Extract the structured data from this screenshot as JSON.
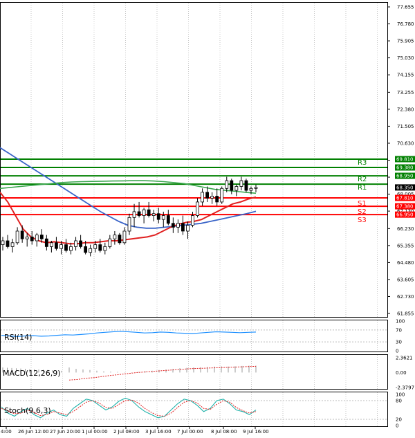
{
  "chart_data": {
    "type": "candlestick",
    "main_panel": {
      "y_ticks": [
        "77.655",
        "76.780",
        "75.905",
        "75.030",
        "74.155",
        "73.255",
        "72.380",
        "71.505",
        "70.630",
        "69.755",
        "68.880",
        "68.005",
        "67.130",
        "66.230",
        "65.355",
        "64.480",
        "63.605",
        "62.730",
        "61.855"
      ],
      "y_range": [
        61.855,
        77.655
      ],
      "levels": [
        {
          "name": "R3",
          "value": 69.81,
          "price_label": "69.810",
          "color": "#008000"
        },
        {
          "name": "",
          "value": 69.38,
          "price_label": "69.380",
          "color": "#008000"
        },
        {
          "name": "R2",
          "value": 68.95,
          "price_label": "68.950",
          "color": "#008000"
        },
        {
          "name": "R1",
          "value": 68.52,
          "price_label": "",
          "color": "#008000"
        },
        {
          "name": "S1",
          "value": 67.81,
          "price_label": "67.810",
          "color": "#ff0000"
        },
        {
          "name": "S2",
          "value": 67.38,
          "price_label": "67.380",
          "color": "#ff0000"
        },
        {
          "name": "S3",
          "value": 66.95,
          "price_label": "66.950",
          "color": "#ff0000"
        }
      ],
      "current_price": 68.35,
      "current_price_label": "68.350",
      "candles": [
        {
          "o": 65.4,
          "h": 65.8,
          "l": 65.1,
          "c": 65.6
        },
        {
          "o": 65.6,
          "h": 65.9,
          "l": 65.2,
          "c": 65.3
        },
        {
          "o": 65.3,
          "h": 65.7,
          "l": 65.0,
          "c": 65.5
        },
        {
          "o": 65.5,
          "h": 66.3,
          "l": 65.4,
          "c": 66.1
        },
        {
          "o": 66.1,
          "h": 66.4,
          "l": 65.5,
          "c": 65.7
        },
        {
          "o": 65.7,
          "h": 66.0,
          "l": 65.3,
          "c": 65.8
        },
        {
          "o": 65.8,
          "h": 66.1,
          "l": 65.4,
          "c": 65.6
        },
        {
          "o": 65.6,
          "h": 66.0,
          "l": 65.3,
          "c": 65.9
        },
        {
          "o": 65.9,
          "h": 66.2,
          "l": 65.5,
          "c": 65.7
        },
        {
          "o": 65.7,
          "h": 65.9,
          "l": 65.1,
          "c": 65.3
        },
        {
          "o": 65.3,
          "h": 65.6,
          "l": 65.0,
          "c": 65.5
        },
        {
          "o": 65.5,
          "h": 65.8,
          "l": 65.1,
          "c": 65.2
        },
        {
          "o": 65.2,
          "h": 65.6,
          "l": 64.9,
          "c": 65.4
        },
        {
          "o": 65.4,
          "h": 65.7,
          "l": 65.0,
          "c": 65.1
        },
        {
          "o": 65.1,
          "h": 65.5,
          "l": 64.9,
          "c": 65.3
        },
        {
          "o": 65.3,
          "h": 65.8,
          "l": 65.1,
          "c": 65.6
        },
        {
          "o": 65.6,
          "h": 65.9,
          "l": 65.2,
          "c": 65.3
        },
        {
          "o": 65.3,
          "h": 65.6,
          "l": 64.9,
          "c": 65.0
        },
        {
          "o": 65.0,
          "h": 65.4,
          "l": 64.8,
          "c": 65.2
        },
        {
          "o": 65.2,
          "h": 65.6,
          "l": 65.0,
          "c": 65.4
        },
        {
          "o": 65.4,
          "h": 65.7,
          "l": 65.0,
          "c": 65.1
        },
        {
          "o": 65.1,
          "h": 65.5,
          "l": 64.9,
          "c": 65.3
        },
        {
          "o": 65.3,
          "h": 65.9,
          "l": 65.2,
          "c": 65.7
        },
        {
          "o": 65.7,
          "h": 66.1,
          "l": 65.4,
          "c": 65.9
        },
        {
          "o": 65.9,
          "h": 66.0,
          "l": 65.4,
          "c": 65.5
        },
        {
          "o": 65.5,
          "h": 66.3,
          "l": 65.4,
          "c": 66.1
        },
        {
          "o": 66.1,
          "h": 67.0,
          "l": 65.9,
          "c": 66.8
        },
        {
          "o": 66.8,
          "h": 67.5,
          "l": 66.3,
          "c": 67.1
        },
        {
          "o": 67.1,
          "h": 67.6,
          "l": 66.8,
          "c": 66.9
        },
        {
          "o": 66.9,
          "h": 67.3,
          "l": 66.5,
          "c": 67.2
        },
        {
          "o": 67.2,
          "h": 67.6,
          "l": 66.8,
          "c": 66.9
        },
        {
          "o": 66.9,
          "h": 67.2,
          "l": 66.6,
          "c": 67.0
        },
        {
          "o": 67.0,
          "h": 67.3,
          "l": 66.5,
          "c": 66.7
        },
        {
          "o": 66.7,
          "h": 67.1,
          "l": 66.3,
          "c": 66.9
        },
        {
          "o": 66.9,
          "h": 67.2,
          "l": 66.4,
          "c": 66.5
        },
        {
          "o": 66.5,
          "h": 66.8,
          "l": 66.0,
          "c": 66.3
        },
        {
          "o": 66.3,
          "h": 66.7,
          "l": 66.0,
          "c": 66.5
        },
        {
          "o": 66.5,
          "h": 66.9,
          "l": 65.9,
          "c": 66.1
        },
        {
          "o": 66.1,
          "h": 66.6,
          "l": 65.7,
          "c": 66.4
        },
        {
          "o": 66.4,
          "h": 67.1,
          "l": 66.3,
          "c": 66.9
        },
        {
          "o": 66.9,
          "h": 67.8,
          "l": 66.8,
          "c": 67.6
        },
        {
          "o": 67.6,
          "h": 68.3,
          "l": 67.4,
          "c": 68.1
        },
        {
          "o": 68.1,
          "h": 68.4,
          "l": 67.6,
          "c": 67.8
        },
        {
          "o": 67.8,
          "h": 68.1,
          "l": 67.5,
          "c": 67.9
        },
        {
          "o": 67.9,
          "h": 68.3,
          "l": 67.4,
          "c": 67.6
        },
        {
          "o": 67.6,
          "h": 68.4,
          "l": 67.5,
          "c": 68.3
        },
        {
          "o": 68.3,
          "h": 68.9,
          "l": 68.1,
          "c": 68.7
        },
        {
          "o": 68.7,
          "h": 68.8,
          "l": 68.0,
          "c": 68.2
        },
        {
          "o": 68.2,
          "h": 68.5,
          "l": 67.9,
          "c": 68.4
        },
        {
          "o": 68.4,
          "h": 68.9,
          "l": 68.2,
          "c": 68.7
        },
        {
          "o": 68.7,
          "h": 68.8,
          "l": 68.1,
          "c": 68.2
        },
        {
          "o": 68.2,
          "h": 68.4,
          "l": 68.0,
          "c": 68.3
        },
        {
          "o": 68.3,
          "h": 68.5,
          "l": 68.1,
          "c": 68.35
        }
      ],
      "ma_slow_blue": [
        70.4,
        70.1,
        69.8,
        69.5,
        69.2,
        68.9,
        68.6,
        68.3,
        68.0,
        67.7,
        67.4,
        67.1,
        66.85,
        66.6,
        66.4,
        66.3,
        66.25,
        66.25,
        66.3,
        66.35,
        66.4,
        66.45,
        66.5,
        66.6,
        66.7,
        66.8,
        66.9,
        67.0,
        67.12
      ],
      "ma_mid_green": [
        68.3,
        68.35,
        68.4,
        68.45,
        68.5,
        68.55,
        68.6,
        68.63,
        68.65,
        68.66,
        68.67,
        68.68,
        68.69,
        68.7,
        68.7,
        68.68,
        68.65,
        68.6,
        68.55,
        68.45,
        68.35,
        68.25,
        68.2,
        68.15,
        68.1,
        68.05
      ],
      "ma_fast_red": [
        68.1,
        67.6,
        66.9,
        66.2,
        65.8,
        65.6,
        65.5,
        65.55,
        65.5,
        65.45,
        65.45,
        65.5,
        65.5,
        65.55,
        65.6,
        65.6,
        65.65,
        65.7,
        65.75,
        65.8,
        65.9,
        66.1,
        66.3,
        66.45,
        66.55,
        66.6,
        66.7,
        66.9,
        67.1,
        67.3,
        67.5,
        67.6,
        67.75,
        67.85
      ]
    },
    "x_labels": [
      "4:00",
      "26 Jun 12:00",
      "27 Jun 20:00",
      "1 Jul 00:00",
      "2 Jul 08:00",
      "3 Jul 16:00",
      "7 Jul 00:00",
      "8 Jul 08:00",
      "9 Jul 16:00"
    ],
    "rsi_panel": {
      "label": "RSI(14)",
      "y_ticks": [
        "100",
        "70",
        "30",
        "0"
      ],
      "values": [
        52,
        50,
        48,
        50,
        51,
        49,
        50,
        52,
        54,
        53,
        55,
        57,
        60,
        62,
        64,
        66,
        64,
        62,
        60,
        61,
        63,
        62,
        60,
        59,
        58,
        60,
        62,
        64,
        63,
        62,
        61,
        62,
        63
      ]
    },
    "macd_panel": {
      "label": "MACD(12,26,9)",
      "y_ticks": [
        "2.3621",
        "0.00",
        "-2.3797"
      ],
      "histogram": [
        0.8,
        0.6,
        0.5,
        0.4,
        0.3,
        0.2,
        0.15,
        0.1,
        0.05,
        0.05,
        0.1,
        0.2,
        0.3,
        0.4,
        0.5,
        0.6,
        0.7,
        0.75,
        0.8,
        0.85,
        0.9,
        0.95,
        1.0,
        0.95,
        1.0,
        1.05,
        1.1,
        1.1
      ],
      "signal": [
        -1.2,
        -1.1,
        -0.9,
        -0.8,
        -0.6,
        -0.45,
        -0.3,
        -0.15,
        0.0,
        0.1,
        0.2,
        0.3,
        0.4,
        0.5,
        0.6,
        0.65,
        0.7,
        0.75,
        0.8,
        0.85,
        0.9,
        0.95,
        1.0
      ]
    },
    "stoch_panel": {
      "label": "Stoch(9,6,3)",
      "y_ticks": [
        "100",
        "80",
        "20",
        "0"
      ],
      "k": [
        60,
        40,
        30,
        45,
        55,
        35,
        25,
        40,
        50,
        35,
        30,
        55,
        70,
        85,
        80,
        65,
        50,
        60,
        78,
        88,
        80,
        60,
        45,
        35,
        25,
        30,
        50,
        70,
        85,
        80,
        65,
        45,
        55,
        80,
        85,
        70,
        50,
        45,
        35,
        50
      ],
      "d": [
        55,
        48,
        38,
        40,
        50,
        42,
        32,
        36,
        45,
        40,
        35,
        45,
        60,
        75,
        80,
        72,
        58,
        55,
        68,
        80,
        82,
        72,
        55,
        42,
        32,
        30,
        40,
        58,
        75,
        80,
        72,
        55,
        52,
        68,
        80,
        75,
        58,
        48,
        40,
        45
      ]
    }
  }
}
